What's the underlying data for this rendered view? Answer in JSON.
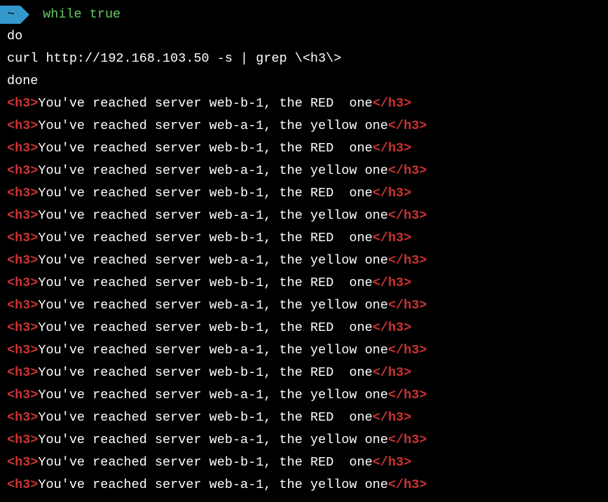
{
  "prompt": {
    "dir": "~",
    "cmd1": "while",
    "cmd2": "true"
  },
  "commands": {
    "line1": "do",
    "line2": "curl http://192.168.103.50 -s | grep \\<h3\\>",
    "line3": "done"
  },
  "tag_open": "<h3>",
  "tag_close": "</h3>",
  "msg_prefix": "You've reached server ",
  "servers": {
    "red": "web-b-1, the RED  one",
    "yellow": "web-a-1, the yellow one"
  },
  "output_lines": [
    "red",
    "yellow",
    "red",
    "yellow",
    "red",
    "yellow",
    "red",
    "yellow",
    "red",
    "yellow",
    "red",
    "yellow",
    "red",
    "yellow",
    "red",
    "yellow",
    "red",
    "yellow"
  ]
}
